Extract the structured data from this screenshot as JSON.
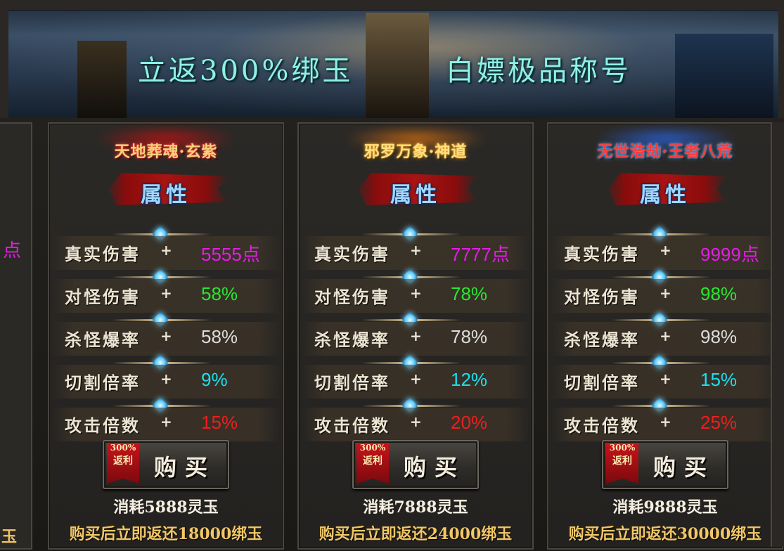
{
  "banner": {
    "left_text": "立返300%绑玉",
    "right_text": "白嫖极品称号"
  },
  "left_partial": {
    "value_fragment": "点",
    "text_fragment": "玉"
  },
  "cards": [
    {
      "title": "天地葬魂·玄紫",
      "title_colors": [
        "#ff3a3a",
        "#f2d37a"
      ],
      "flame_color": "#d81010",
      "attr_label": "属性",
      "rows": [
        {
          "label": "真实伤害",
          "plus": "+",
          "value": "5555点",
          "color": "#e21ee5"
        },
        {
          "label": "对怪伤害",
          "plus": "+",
          "value": "58%",
          "color": "#27e830"
        },
        {
          "label": "杀怪爆率",
          "plus": "+",
          "value": "58%",
          "color": "#dcdcdc"
        },
        {
          "label": "切割倍率",
          "plus": "+",
          "value": "9%",
          "color": "#19e0f0"
        },
        {
          "label": "攻击倍数",
          "plus": "+",
          "value": "15%",
          "color": "#ee1e1e"
        }
      ],
      "buy": {
        "tag_top": "300%",
        "tag_bottom": "返利",
        "label": "购买"
      },
      "cost": "消耗5888灵玉",
      "return": "购买后立即返还18000绑玉"
    },
    {
      "title": "邪罗万象·神道",
      "title_colors": [
        "#ffb030",
        "#ffe080"
      ],
      "flame_color": "#f07a10",
      "attr_label": "属性",
      "rows": [
        {
          "label": "真实伤害",
          "plus": "+",
          "value": "7777点",
          "color": "#e21ee5"
        },
        {
          "label": "对怪伤害",
          "plus": "+",
          "value": "78%",
          "color": "#27e830"
        },
        {
          "label": "杀怪爆率",
          "plus": "+",
          "value": "78%",
          "color": "#dcdcdc"
        },
        {
          "label": "切割倍率",
          "plus": "+",
          "value": "12%",
          "color": "#19e0f0"
        },
        {
          "label": "攻击倍数",
          "plus": "+",
          "value": "20%",
          "color": "#ee1e1e"
        }
      ],
      "buy": {
        "tag_top": "300%",
        "tag_bottom": "返利",
        "label": "购买"
      },
      "cost": "消耗7888灵玉",
      "return": "购买后立即返还24000绑玉"
    },
    {
      "title": "无世浩劫·王者八荒",
      "title_colors": [
        "#6ab8ff",
        "#ff3a3a"
      ],
      "flame_color": "#2a6cff",
      "attr_label": "属性",
      "rows": [
        {
          "label": "真实伤害",
          "plus": "+",
          "value": "9999点",
          "color": "#e21ee5"
        },
        {
          "label": "对怪伤害",
          "plus": "+",
          "value": "98%",
          "color": "#27e830"
        },
        {
          "label": "杀怪爆率",
          "plus": "+",
          "value": "98%",
          "color": "#dcdcdc"
        },
        {
          "label": "切割倍率",
          "plus": "+",
          "value": "15%",
          "color": "#19e0f0"
        },
        {
          "label": "攻击倍数",
          "plus": "+",
          "value": "25%",
          "color": "#ee1e1e"
        }
      ],
      "buy": {
        "tag_top": "300%",
        "tag_bottom": "返利",
        "label": "购买"
      },
      "cost": "消耗9888灵玉",
      "return": "购买后立即返还30000绑玉"
    }
  ]
}
